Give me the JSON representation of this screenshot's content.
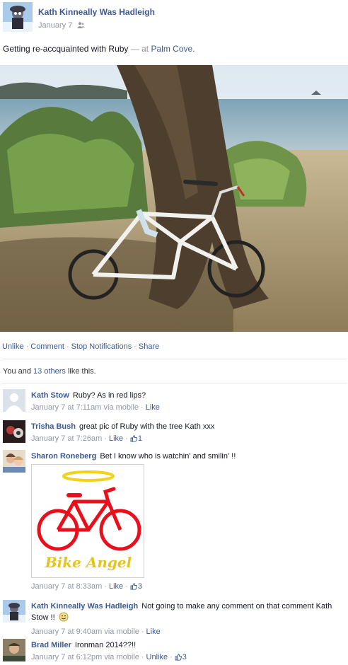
{
  "post": {
    "author": "Kath Kinneally Was Hadleigh",
    "date": "January 7",
    "privacy_icon": "friends-icon",
    "text_main": "Getting re-accquainted with Ruby",
    "text_dash": "—",
    "text_at": "at",
    "location": "Palm Cove."
  },
  "actions": {
    "unlike": "Unlike",
    "comment": "Comment",
    "stop_notifications": "Stop Notifications",
    "share": "Share",
    "separator": "·"
  },
  "likes": {
    "prefix": "You and",
    "others_link": "13 others",
    "suffix": "like this."
  },
  "comments": [
    {
      "name": "Kath Stow",
      "text": "Ruby? As in red lips?",
      "time": "January 7 at 7:11am via mobile",
      "action": "Like",
      "like_count": ""
    },
    {
      "name": "Trisha Bush",
      "text": "great pic of Ruby with the tree Kath xxx",
      "time": "January 7 at 7:26am",
      "action": "Like",
      "like_count": "1"
    },
    {
      "name": "Sharon Roneberg",
      "text": "Bet I know who is watchin' and smilin' !!",
      "time": "January 7 at 8:33am",
      "action": "Like",
      "like_count": "3",
      "image_caption": "Bike Angel"
    },
    {
      "name": "Kath Kinneally Was Hadleigh",
      "text": "Not going to make any comment on that comment Kath Stow !!",
      "time": "January 7 at 9:40am via mobile",
      "action": "Like",
      "like_count": ""
    },
    {
      "name": "Brad Miller",
      "text": "Ironman 2014??!!",
      "time": "January 7 at 6:12pm via mobile",
      "action": "Unlike",
      "like_count": "3"
    }
  ],
  "colors": {
    "link": "#3b5998",
    "meta": "#9197a3",
    "angel_red": "#e8101c",
    "angel_yellow": "#f2d21a"
  }
}
